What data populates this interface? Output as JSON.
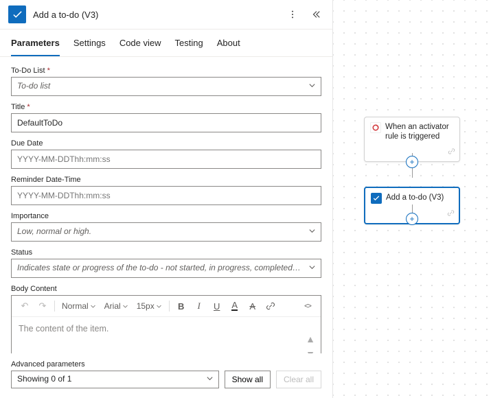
{
  "header": {
    "title": "Add a to-do (V3)"
  },
  "tabs": [
    "Parameters",
    "Settings",
    "Code view",
    "Testing",
    "About"
  ],
  "active_tab": "Parameters",
  "fields": {
    "todo_list": {
      "label": "To-Do List",
      "value": "To-do list"
    },
    "title": {
      "label": "Title",
      "value": "DefaultToDo"
    },
    "due_date": {
      "label": "Due Date",
      "placeholder": "YYYY-MM-DDThh:mm:ss"
    },
    "reminder": {
      "label": "Reminder Date-Time",
      "placeholder": "YYYY-MM-DDThh:mm:ss"
    },
    "importance": {
      "label": "Importance",
      "value": "Low, normal or high."
    },
    "status": {
      "label": "Status",
      "value": "Indicates state or progress of the to-do - not started, in progress, completed, waiting on o..."
    },
    "body": {
      "label": "Body Content",
      "placeholder": "The content of the item."
    }
  },
  "editor": {
    "style": "Normal",
    "font": "Arial",
    "size": "15px",
    "tools": {
      "bold": "B",
      "italic": "I",
      "underline": "U",
      "font_color": "A",
      "clear_format": "A",
      "link": "🔗",
      "code": "</>"
    }
  },
  "advanced": {
    "label": "Advanced parameters",
    "summary": "Showing 0 of 1",
    "show_all": "Show all",
    "clear_all": "Clear all"
  },
  "canvas": {
    "trigger": {
      "title": "When an activator rule is triggered"
    },
    "action": {
      "title": "Add a to-do (V3)"
    }
  }
}
